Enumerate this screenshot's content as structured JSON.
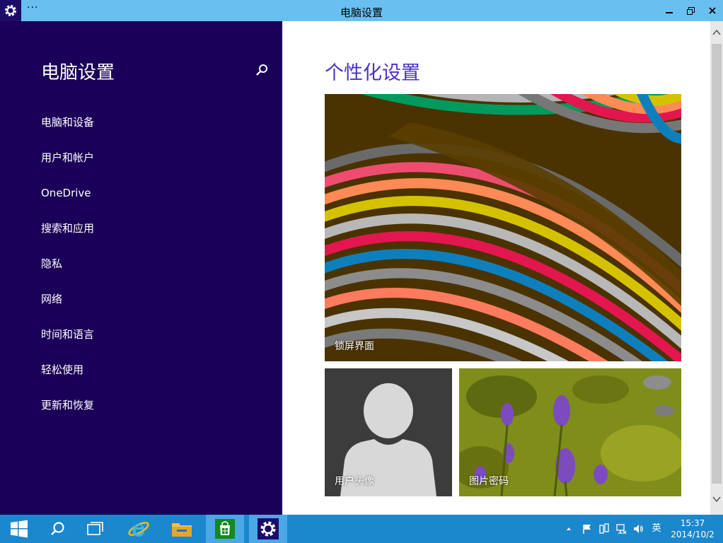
{
  "window": {
    "title": "电脑设置",
    "menu_dots": "···"
  },
  "sidebar": {
    "title": "电脑设置",
    "items": [
      {
        "label": "电脑和设备"
      },
      {
        "label": "用户和帐户"
      },
      {
        "label": "OneDrive"
      },
      {
        "label": "搜索和应用"
      },
      {
        "label": "隐私"
      },
      {
        "label": "网络"
      },
      {
        "label": "时间和语言"
      },
      {
        "label": "轻松使用"
      },
      {
        "label": "更新和恢复"
      }
    ]
  },
  "main": {
    "title": "个性化设置",
    "tiles": {
      "lock_screen": "锁屏界面",
      "account_picture": "用户头像",
      "picture_password": "图片密码"
    }
  },
  "taskbar": {
    "tray": {
      "ime": "英",
      "time": "15:37",
      "date": "2014/10/2"
    }
  },
  "colors": {
    "titlebar": "#69c0f0",
    "sidebar": "#1a0058",
    "accent_title": "#4a32c6",
    "taskbar": "#1b87cd"
  }
}
